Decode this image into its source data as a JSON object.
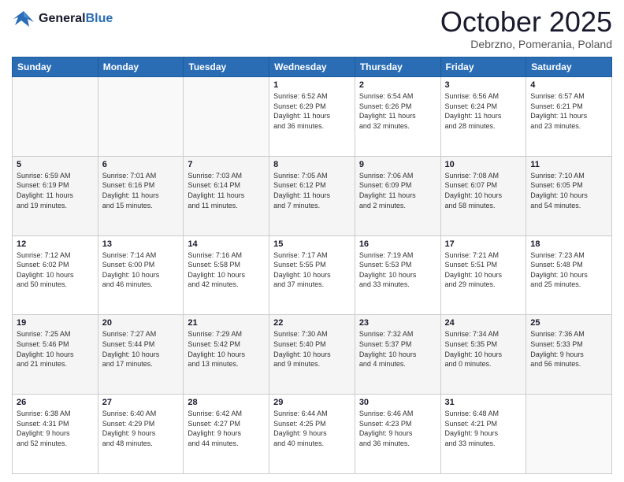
{
  "header": {
    "logo_line1": "General",
    "logo_line2": "Blue",
    "month": "October 2025",
    "location": "Debrzno, Pomerania, Poland"
  },
  "days_of_week": [
    "Sunday",
    "Monday",
    "Tuesday",
    "Wednesday",
    "Thursday",
    "Friday",
    "Saturday"
  ],
  "weeks": [
    [
      {
        "day": "",
        "info": ""
      },
      {
        "day": "",
        "info": ""
      },
      {
        "day": "",
        "info": ""
      },
      {
        "day": "1",
        "info": "Sunrise: 6:52 AM\nSunset: 6:29 PM\nDaylight: 11 hours\nand 36 minutes."
      },
      {
        "day": "2",
        "info": "Sunrise: 6:54 AM\nSunset: 6:26 PM\nDaylight: 11 hours\nand 32 minutes."
      },
      {
        "day": "3",
        "info": "Sunrise: 6:56 AM\nSunset: 6:24 PM\nDaylight: 11 hours\nand 28 minutes."
      },
      {
        "day": "4",
        "info": "Sunrise: 6:57 AM\nSunset: 6:21 PM\nDaylight: 11 hours\nand 23 minutes."
      }
    ],
    [
      {
        "day": "5",
        "info": "Sunrise: 6:59 AM\nSunset: 6:19 PM\nDaylight: 11 hours\nand 19 minutes."
      },
      {
        "day": "6",
        "info": "Sunrise: 7:01 AM\nSunset: 6:16 PM\nDaylight: 11 hours\nand 15 minutes."
      },
      {
        "day": "7",
        "info": "Sunrise: 7:03 AM\nSunset: 6:14 PM\nDaylight: 11 hours\nand 11 minutes."
      },
      {
        "day": "8",
        "info": "Sunrise: 7:05 AM\nSunset: 6:12 PM\nDaylight: 11 hours\nand 7 minutes."
      },
      {
        "day": "9",
        "info": "Sunrise: 7:06 AM\nSunset: 6:09 PM\nDaylight: 11 hours\nand 2 minutes."
      },
      {
        "day": "10",
        "info": "Sunrise: 7:08 AM\nSunset: 6:07 PM\nDaylight: 10 hours\nand 58 minutes."
      },
      {
        "day": "11",
        "info": "Sunrise: 7:10 AM\nSunset: 6:05 PM\nDaylight: 10 hours\nand 54 minutes."
      }
    ],
    [
      {
        "day": "12",
        "info": "Sunrise: 7:12 AM\nSunset: 6:02 PM\nDaylight: 10 hours\nand 50 minutes."
      },
      {
        "day": "13",
        "info": "Sunrise: 7:14 AM\nSunset: 6:00 PM\nDaylight: 10 hours\nand 46 minutes."
      },
      {
        "day": "14",
        "info": "Sunrise: 7:16 AM\nSunset: 5:58 PM\nDaylight: 10 hours\nand 42 minutes."
      },
      {
        "day": "15",
        "info": "Sunrise: 7:17 AM\nSunset: 5:55 PM\nDaylight: 10 hours\nand 37 minutes."
      },
      {
        "day": "16",
        "info": "Sunrise: 7:19 AM\nSunset: 5:53 PM\nDaylight: 10 hours\nand 33 minutes."
      },
      {
        "day": "17",
        "info": "Sunrise: 7:21 AM\nSunset: 5:51 PM\nDaylight: 10 hours\nand 29 minutes."
      },
      {
        "day": "18",
        "info": "Sunrise: 7:23 AM\nSunset: 5:48 PM\nDaylight: 10 hours\nand 25 minutes."
      }
    ],
    [
      {
        "day": "19",
        "info": "Sunrise: 7:25 AM\nSunset: 5:46 PM\nDaylight: 10 hours\nand 21 minutes."
      },
      {
        "day": "20",
        "info": "Sunrise: 7:27 AM\nSunset: 5:44 PM\nDaylight: 10 hours\nand 17 minutes."
      },
      {
        "day": "21",
        "info": "Sunrise: 7:29 AM\nSunset: 5:42 PM\nDaylight: 10 hours\nand 13 minutes."
      },
      {
        "day": "22",
        "info": "Sunrise: 7:30 AM\nSunset: 5:40 PM\nDaylight: 10 hours\nand 9 minutes."
      },
      {
        "day": "23",
        "info": "Sunrise: 7:32 AM\nSunset: 5:37 PM\nDaylight: 10 hours\nand 4 minutes."
      },
      {
        "day": "24",
        "info": "Sunrise: 7:34 AM\nSunset: 5:35 PM\nDaylight: 10 hours\nand 0 minutes."
      },
      {
        "day": "25",
        "info": "Sunrise: 7:36 AM\nSunset: 5:33 PM\nDaylight: 9 hours\nand 56 minutes."
      }
    ],
    [
      {
        "day": "26",
        "info": "Sunrise: 6:38 AM\nSunset: 4:31 PM\nDaylight: 9 hours\nand 52 minutes."
      },
      {
        "day": "27",
        "info": "Sunrise: 6:40 AM\nSunset: 4:29 PM\nDaylight: 9 hours\nand 48 minutes."
      },
      {
        "day": "28",
        "info": "Sunrise: 6:42 AM\nSunset: 4:27 PM\nDaylight: 9 hours\nand 44 minutes."
      },
      {
        "day": "29",
        "info": "Sunrise: 6:44 AM\nSunset: 4:25 PM\nDaylight: 9 hours\nand 40 minutes."
      },
      {
        "day": "30",
        "info": "Sunrise: 6:46 AM\nSunset: 4:23 PM\nDaylight: 9 hours\nand 36 minutes."
      },
      {
        "day": "31",
        "info": "Sunrise: 6:48 AM\nSunset: 4:21 PM\nDaylight: 9 hours\nand 33 minutes."
      },
      {
        "day": "",
        "info": ""
      }
    ]
  ]
}
